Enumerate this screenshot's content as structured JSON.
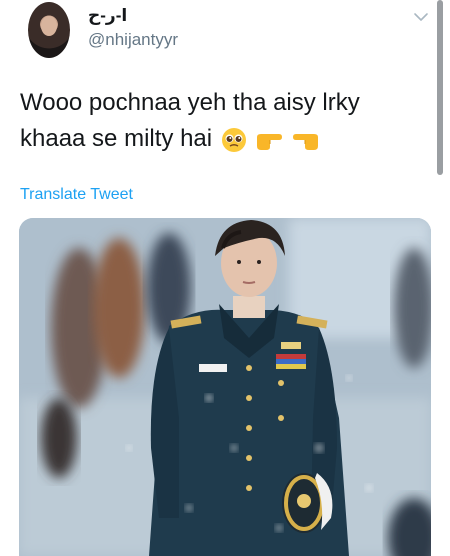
{
  "tweet": {
    "display_name": "ا-ر-ح",
    "handle": "@nhijantyyr",
    "text_line1": "Wooo pochnaa yeh tha aisy lrky",
    "text_line2": "khaaa se milty hai",
    "translate_label": "Translate Tweet"
  },
  "icons": {
    "menu": "chevron-down-icon",
    "emoji_1": "pleading-face-emoji",
    "emoji_2": "pointing-right-emoji",
    "emoji_3": "pointing-left-emoji"
  },
  "colors": {
    "link": "#1da1f2",
    "handle": "#657786",
    "text": "#14171a"
  }
}
